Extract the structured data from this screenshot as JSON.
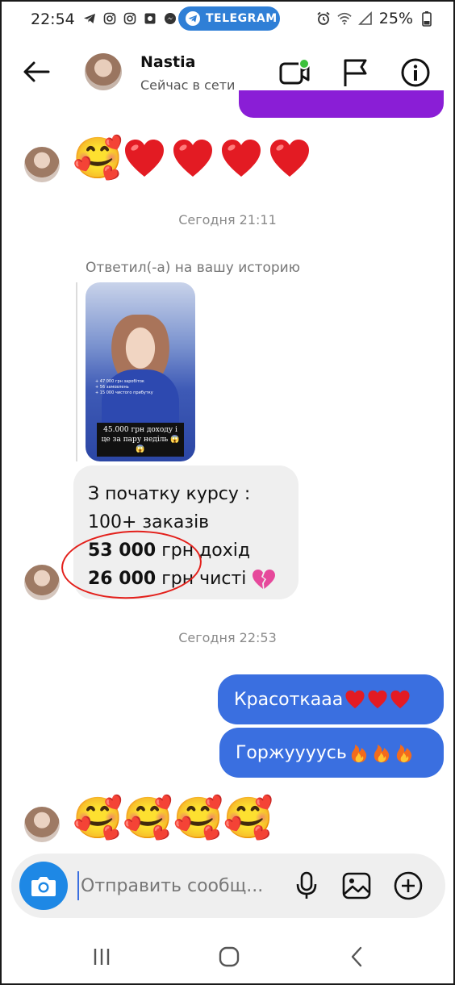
{
  "status_bar": {
    "time": "22:54",
    "telegram_label": "TELEGRAM",
    "battery": "25%"
  },
  "header": {
    "name": "Nastia",
    "status": "Сейчас в сети"
  },
  "messages": {
    "timestamp_1": "Сегодня 21:11",
    "reply_label": "Ответил(-а) на вашу историю",
    "story_caption": "45.000 грн доходу і це за пару неділь 😱😱",
    "story_small_text": "+ 47 000 грн заробіток\n+ 56 замовлень\n+ 15 000 чистого прибутку",
    "course_line1": "З початку курсу :",
    "course_line2": "100+ заказів",
    "course_line3_bold": "53 000",
    "course_line3_rest": " грн дохід",
    "course_line4_bold": "26 000",
    "course_line4_rest": " грн чисті",
    "timestamp_2": "Сегодня 22:53",
    "sent_1": "Красоткааа",
    "sent_2": "Горжуууусь"
  },
  "composer": {
    "placeholder": "Отправить сообщ..."
  },
  "colors": {
    "accent_blue": "#3a6fe0",
    "camera_blue": "#1e88e5",
    "purple": "#8a1ed6",
    "telegram_blue": "#2f7fd6",
    "annotation_red": "#e3201b"
  },
  "icons": {
    "header": [
      "back-arrow-icon",
      "video-call-icon",
      "flag-icon",
      "info-icon"
    ],
    "composer": [
      "camera-icon",
      "microphone-icon",
      "gallery-icon",
      "plus-icon"
    ],
    "nav": [
      "recents-icon",
      "home-icon",
      "back-icon"
    ]
  }
}
